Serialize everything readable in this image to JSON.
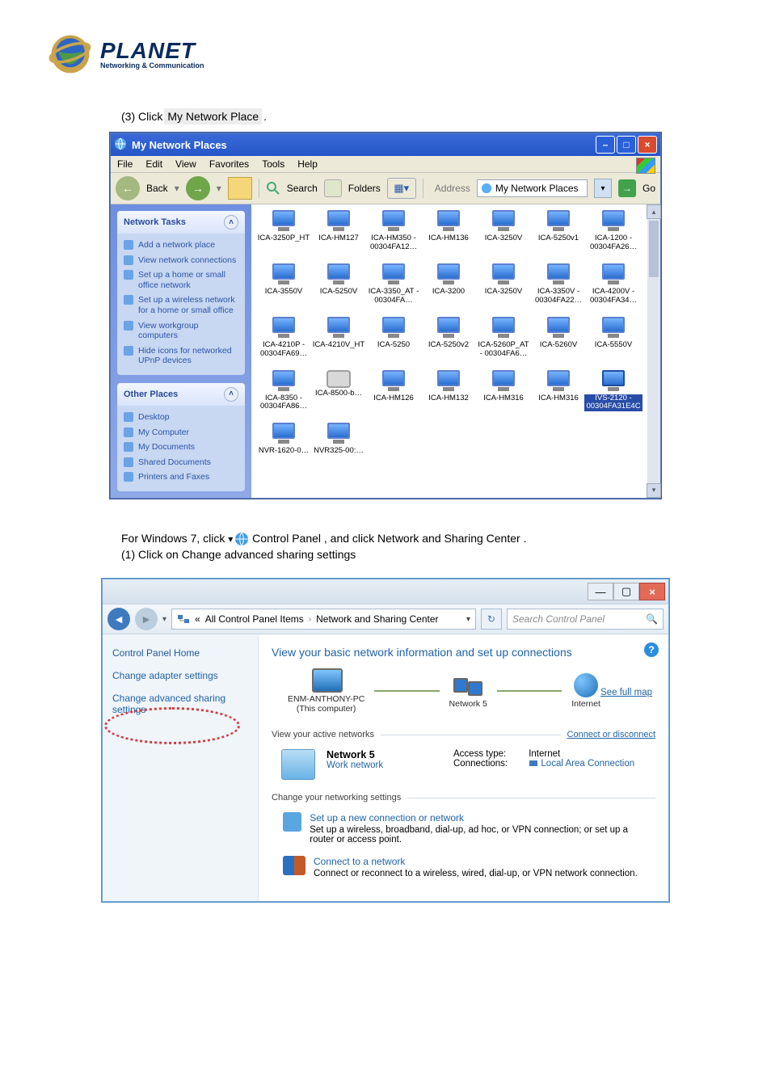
{
  "logo": {
    "word": "PLANET",
    "tagline": "Networking & Communication"
  },
  "intro": {
    "prefix": "(3) Click ",
    "btn1": "My Network Place",
    "suffix": "."
  },
  "screenshot1": {
    "title": "My Network Places",
    "menubar": [
      "File",
      "Edit",
      "View",
      "Favorites",
      "Tools",
      "Help"
    ],
    "toolbar": {
      "back": "Back",
      "search": "Search",
      "folders": "Folders",
      "address_label": "Address",
      "address_value": "My Network Places",
      "go": "Go"
    },
    "side": {
      "tasks_title": "Network Tasks",
      "tasks": [
        "Add a network place",
        "View network connections",
        "Set up a home or small office network",
        "Set up a wireless network for a home or small office",
        "View workgroup computers",
        "Hide icons for networked UPnP devices"
      ],
      "other_title": "Other Places",
      "other": [
        "Desktop",
        "My Computer",
        "My Documents",
        "Shared Documents",
        "Printers and Faxes"
      ]
    },
    "devices": [
      {
        "name": "ICA-3250P_HT"
      },
      {
        "name": "ICA-HM127"
      },
      {
        "name": "ICA-HM350 - 00304FA12…"
      },
      {
        "name": "ICA-HM136"
      },
      {
        "name": "ICA-3250V"
      },
      {
        "name": "ICA-5250v1"
      },
      {
        "name": "ICA-1200 - 00304FA26…"
      },
      {
        "name": "ICA-3550V"
      },
      {
        "name": "ICA-5250V"
      },
      {
        "name": "ICA-3350_AT - 00304FA…"
      },
      {
        "name": "ICA-3200"
      },
      {
        "name": "ICA-3250V"
      },
      {
        "name": "ICA-3350V - 00304FA22…"
      },
      {
        "name": "ICA-4200V - 00304FA34…"
      },
      {
        "name": "ICA-4210P - 00304FA69…"
      },
      {
        "name": "ICA-4210V_HT"
      },
      {
        "name": "ICA-5250"
      },
      {
        "name": "ICA-5250v2"
      },
      {
        "name": "ICA-5260P_AT - 00304FA6…"
      },
      {
        "name": "ICA-5260V"
      },
      {
        "name": "ICA-5550V"
      },
      {
        "name": "ICA-8350 - 00304FA86…"
      },
      {
        "name": "ICA-8500-b…",
        "cam": true
      },
      {
        "name": "ICA-HM126"
      },
      {
        "name": "ICA-HM132"
      },
      {
        "name": "ICA-HM316"
      },
      {
        "name": "ICA-HM316"
      },
      {
        "name": "IVS-2120 - 00304FA31E4C",
        "selected": true
      },
      {
        "name": "NVR-1620-0…"
      },
      {
        "name": "NVR325-00:…"
      }
    ]
  },
  "midpara": {
    "line1_prefix": "For Windows 7, click ",
    "line1_link1": "Control Panel",
    "line1_mid": ", and click ",
    "line1_link2": "Network and Sharing Center",
    "line1_end": ".",
    "line2_prefix": "(1) Click on ",
    "line2_link": "Change advanced sharing settings"
  },
  "screenshot2": {
    "crumb": {
      "level1": "All Control Panel Items",
      "level2": "Network and Sharing Center",
      "sep": "›"
    },
    "search_placeholder": "Search Control Panel",
    "side": {
      "home": "Control Panel Home",
      "links": [
        "Change adapter settings",
        "Change advanced sharing settings"
      ]
    },
    "content": {
      "title": "View your basic network information and set up connections",
      "see_full_map": "See full map",
      "map": {
        "pc": "ENM-ANTHONY-PC",
        "pc_sub": "(This computer)",
        "net": "Network 5",
        "internet": "Internet"
      },
      "active_label": "View your active networks",
      "connect_or": "Connect or disconnect",
      "active_net": {
        "name": "Network 5",
        "type": "Work network",
        "access_label": "Access type:",
        "access_value": "Internet",
        "conn_label": "Connections:",
        "conn_value": "Local Area Connection"
      },
      "change_label": "Change your networking settings",
      "settings": [
        {
          "link": "Set up a new connection or network",
          "desc": "Set up a wireless, broadband, dial-up, ad hoc, or VPN connection; or set up a router or access point."
        },
        {
          "link": "Connect to a network",
          "desc": "Connect or reconnect to a wireless, wired, dial-up, or VPN network connection."
        }
      ]
    }
  }
}
